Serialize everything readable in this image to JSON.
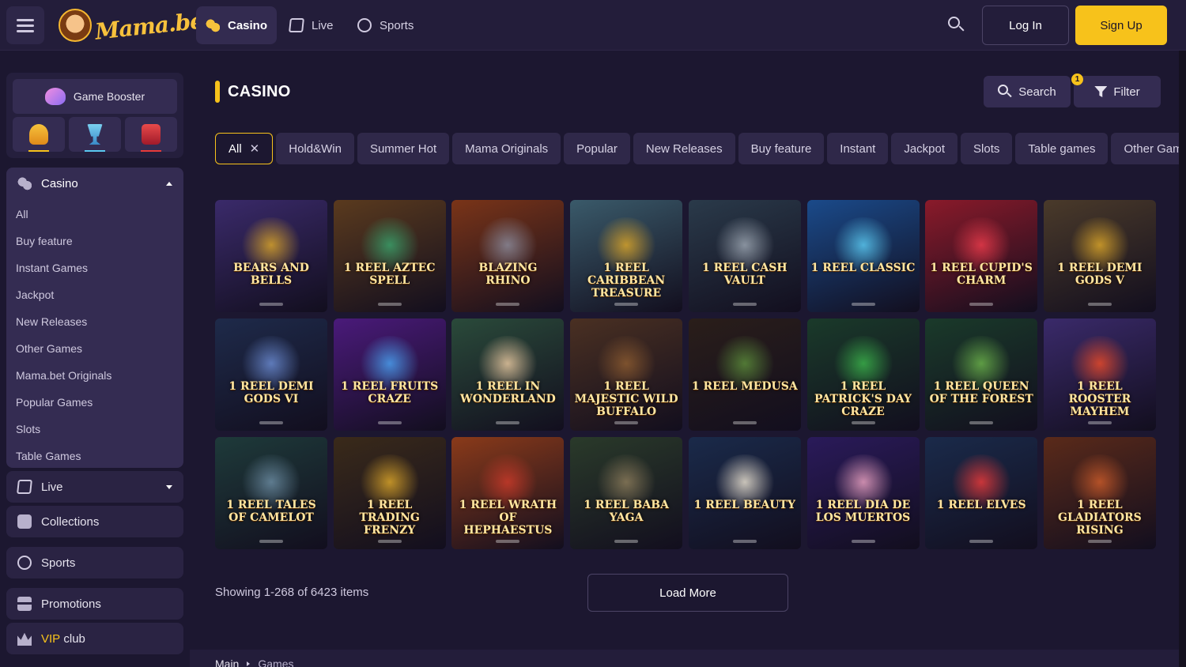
{
  "header": {
    "logo_text": "Mama.bet",
    "tabs": [
      {
        "label": "Casino",
        "icon": "casino-chips-icon"
      },
      {
        "label": "Live",
        "icon": "live-card-icon"
      },
      {
        "label": "Sports",
        "icon": "sports-ball-icon"
      }
    ],
    "login_label": "Log In",
    "signup_label": "Sign Up",
    "accent_color": "#f7c21b"
  },
  "sidebar": {
    "booster_label": "Game Booster",
    "mini_buttons": [
      "stacked-coins-icon",
      "trophy-cup-icon",
      "slot-machine-icon"
    ],
    "casino": {
      "label": "Casino",
      "items": [
        "All",
        "Buy feature",
        "Instant Games",
        "Jackpot",
        "New Releases",
        "Other Games",
        "Mama.bet Originals",
        "Popular Games",
        "Slots",
        "Table Games"
      ]
    },
    "live_label": "Live",
    "collections_label": "Collections",
    "sports_label": "Sports",
    "promotions_label": "Promotions",
    "vip_label": "VIP",
    "vip_suffix": " club"
  },
  "main": {
    "title": "CASINO",
    "search_label": "Search",
    "filter_label": "Filter",
    "filter_badge": "1",
    "chips": [
      "All",
      "Hold&Win",
      "Summer Hot",
      "Mama Originals",
      "Popular",
      "New Releases",
      "Buy feature",
      "Instant",
      "Jackpot",
      "Slots",
      "Table games",
      "Other Games"
    ],
    "games": [
      {
        "title": "Bears and Bells",
        "bg": "#3a2a6a",
        "glow": "#d9a42a"
      },
      {
        "title": "1 Reel Aztec Spell",
        "bg": "#5a3a1e",
        "glow": "#3aa06a"
      },
      {
        "title": "Blazing Rhino",
        "bg": "#7a3418",
        "glow": "#8a8a9a"
      },
      {
        "title": "1 Reel Caribbean Treasure",
        "bg": "#3a5a6a",
        "glow": "#d9a42a"
      },
      {
        "title": "1 Reel Cash Vault",
        "bg": "#2a3a4a",
        "glow": "#9aa4b0"
      },
      {
        "title": "1 Reel Classic",
        "bg": "#1a4a8a",
        "glow": "#5ac8f0"
      },
      {
        "title": "1 Reel Cupid's Charm",
        "bg": "#8a1a2a",
        "glow": "#e83a4a"
      },
      {
        "title": "1 Reel Demi Gods V",
        "bg": "#4a3a2a",
        "glow": "#d9a42a"
      },
      {
        "title": "1 Reel Demi Gods VI",
        "bg": "#1e2a4a",
        "glow": "#6a8ad0"
      },
      {
        "title": "1 Reel Fruits Craze",
        "bg": "#4a1a7a",
        "glow": "#4aa0f0"
      },
      {
        "title": "1 Reel In Wonderland",
        "bg": "#2a4a3a",
        "glow": "#e8c8a0"
      },
      {
        "title": "1 Reel Majestic Wild Buffalo",
        "bg": "#4a3022",
        "glow": "#8a5a30"
      },
      {
        "title": "1 Reel Medusa",
        "bg": "#2a1e1a",
        "glow": "#5a8a3a"
      },
      {
        "title": "1 Reel Patrick's Day Craze",
        "bg": "#1a3a2a",
        "glow": "#3ab04a"
      },
      {
        "title": "1 Reel Queen of the Forest",
        "bg": "#1a3a2a",
        "glow": "#6ab04a"
      },
      {
        "title": "1 Reel Rooster Mayhem",
        "bg": "#3a2a6a",
        "glow": "#e84a2a"
      },
      {
        "title": "1 Reel Tales of Camelot",
        "bg": "#1e3a3a",
        "glow": "#6a8aa0"
      },
      {
        "title": "1 Reel Trading Frenzy",
        "bg": "#3a2a1a",
        "glow": "#d9a42a"
      },
      {
        "title": "1 Reel Wrath of Hephaestus",
        "bg": "#8a3a1a",
        "glow": "#c83a2a"
      },
      {
        "title": "1 Reel Baba Yaga",
        "bg": "#2a3a2a",
        "glow": "#8a7a5a"
      },
      {
        "title": "1 Reel Beauty",
        "bg": "#1a2a4a",
        "glow": "#e8e0d0"
      },
      {
        "title": "1 Reel Dia de los Muertos",
        "bg": "#2a1a5a",
        "glow": "#e8a0c0"
      },
      {
        "title": "1 Reel Elves",
        "bg": "#1a2a4a",
        "glow": "#e83a3a"
      },
      {
        "title": "1 Reel Gladiators Rising",
        "bg": "#5a2a1a",
        "glow": "#c85a2a"
      }
    ],
    "showing_text": "Showing 1-268 of 6423 items",
    "load_more_label": "Load More",
    "breadcrumb": [
      "Main",
      "Games"
    ]
  }
}
